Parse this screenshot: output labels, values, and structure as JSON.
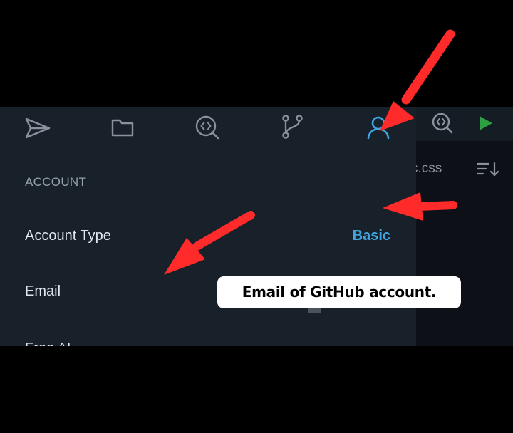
{
  "toolbar": {
    "icons": [
      {
        "name": "send-icon"
      },
      {
        "name": "folder-icon"
      },
      {
        "name": "search-code-icon"
      },
      {
        "name": "git-branch-icon"
      },
      {
        "name": "account-icon",
        "active": true
      }
    ],
    "right_icons": [
      {
        "name": "search-code-icon"
      },
      {
        "name": "run-icon"
      }
    ]
  },
  "editor": {
    "tab_label": "c.css",
    "sort_icon": "sort-icon"
  },
  "panel": {
    "section_title": "ACCOUNT",
    "rows": [
      {
        "label": "Account Type",
        "value": "Basic"
      },
      {
        "label": "Email",
        "value": ""
      },
      {
        "label": "Free AI",
        "value": ""
      }
    ]
  },
  "annotation": {
    "tooltip": "Email of GitHub account."
  },
  "colors": {
    "panel_bg": "#182029",
    "accent": "#3fa5e0",
    "run_green": "#2ea043",
    "arrow_red": "#ff2a2a"
  }
}
